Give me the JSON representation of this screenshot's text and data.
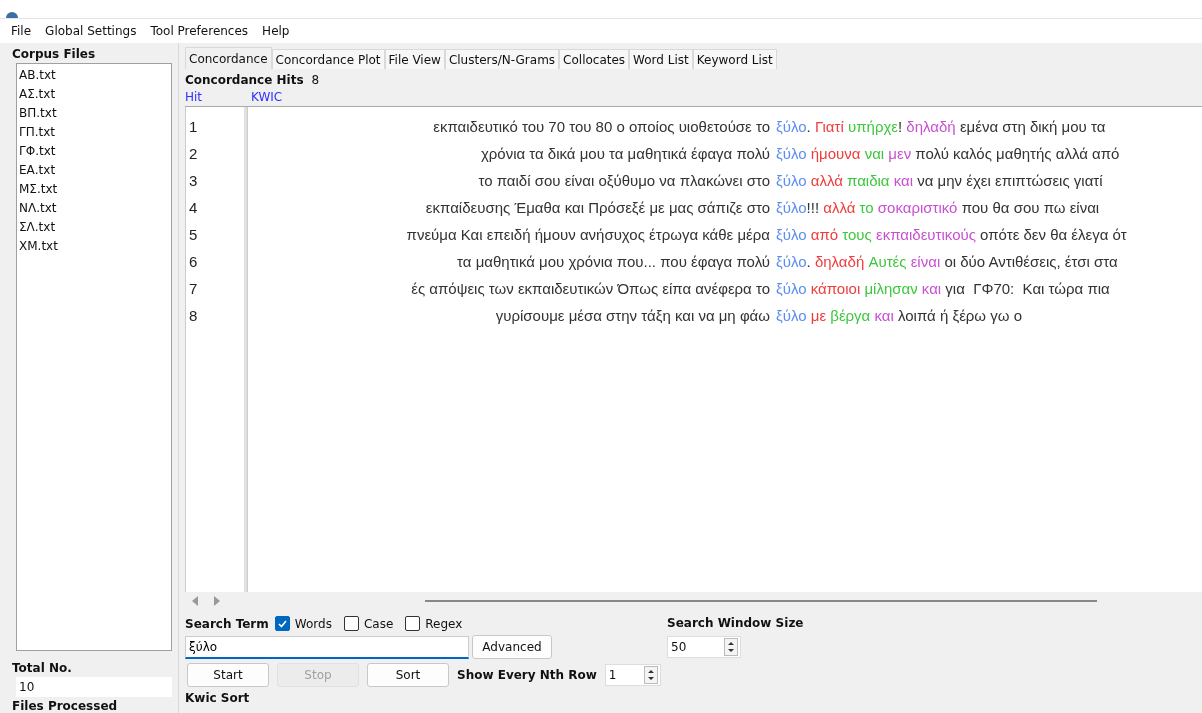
{
  "menu": [
    "File",
    "Global Settings",
    "Tool Preferences",
    "Help"
  ],
  "corpus_files": {
    "title": "Corpus Files",
    "items": [
      "AB.txt",
      "ΑΣ.txt",
      "ΒΠ.txt",
      "ΓΠ.txt",
      "ΓΦ.txt",
      "ΕΑ.txt",
      "ΜΣ.txt",
      "ΝΛ.txt",
      "ΣΛ.txt",
      "ΧΜ.txt"
    ]
  },
  "total": {
    "label": "Total No.",
    "value": "10"
  },
  "files_processed": {
    "label": "Files Processed"
  },
  "tabs": [
    {
      "label": "Concordance",
      "selected": true
    },
    {
      "label": "Concordance Plot",
      "selected": false
    },
    {
      "label": "File View",
      "selected": false
    },
    {
      "label": "Clusters/N-Grams",
      "selected": false
    },
    {
      "label": "Collocates",
      "selected": false
    },
    {
      "label": "Word List",
      "selected": false
    },
    {
      "label": "Keyword List",
      "selected": false
    }
  ],
  "hits": {
    "label": "Concordance Hits",
    "value": "8"
  },
  "columns": [
    "Hit",
    "KWIC"
  ],
  "rows": [
    {
      "hit": "1",
      "left": "εκπαιδευτικό του 70 του 80 ο οποίος υιοθετούσε το",
      "keyword": "ξύλο",
      "prefix": ".",
      "words": [
        {
          "text": "Γιατί",
          "color": "#f03c3c"
        },
        {
          "text": "υπήρχε",
          "color": "#3cc83c",
          "suffix": "!"
        },
        {
          "text": "δηλαδή",
          "color": "#c850d2"
        }
      ],
      "rest": "εμένα στη δική μου τα"
    },
    {
      "hit": "2",
      "left": "χρόνια τα δικά μου τα μαθητικά έφαγα πολύ",
      "keyword": "ξύλο",
      "words": [
        {
          "text": "ήμουνα",
          "color": "#f03c3c"
        },
        {
          "text": "ναι",
          "color": "#3cc83c"
        },
        {
          "text": "μεν",
          "color": "#c850d2"
        }
      ],
      "rest": "πολύ καλός μαθητής αλλά από"
    },
    {
      "hit": "3",
      "left": "το παιδί σου είναι οξύθυμο να πλακώνει στο",
      "keyword": "ξύλο",
      "words": [
        {
          "text": "αλλά",
          "color": "#f03c3c"
        },
        {
          "text": "παιδια",
          "color": "#3cc83c"
        },
        {
          "text": "και",
          "color": "#c850d2"
        }
      ],
      "rest": "να μην έχει επιπτώσεις γιατί"
    },
    {
      "hit": "4",
      "left": "εκπαίδευσης Έμαθα και Πρόσεξέ με μας σάπιζε στο",
      "keyword": "ξύλο",
      "prefix": "!!!",
      "words": [
        {
          "text": "αλλά",
          "color": "#f03c3c"
        },
        {
          "text": "το",
          "color": "#3cc83c"
        },
        {
          "text": "σοκαριστικό",
          "color": "#c850d2"
        }
      ],
      "rest": "που θα σου πω είναι"
    },
    {
      "hit": "5",
      "left": "πνεύμα Και επειδή ήμουν ανήσυχος έτρωγα κάθε μέρα",
      "keyword": "ξύλο",
      "words": [
        {
          "text": "από",
          "color": "#f03c3c"
        },
        {
          "text": "τους",
          "color": "#3cc83c"
        },
        {
          "text": "εκπαιδευτικούς",
          "color": "#c850d2"
        }
      ],
      "rest": "οπότε δεν θα έλεγα ότ"
    },
    {
      "hit": "6",
      "left": "τα μαθητικά μου χρόνια που... που  έφαγα πολύ",
      "keyword": "ξύλο",
      "prefix": ".",
      "words": [
        {
          "text": "δηλαδή",
          "color": "#f03c3c"
        },
        {
          "text": "Αυτές",
          "color": "#3cc83c"
        },
        {
          "text": "είναι",
          "color": "#c850d2"
        }
      ],
      "rest": "οι δύο Αντιθέσεις, έτσι στα"
    },
    {
      "hit": "7",
      "left": "ές απόψεις των εκπαιδευτικών Όπως είπα ανέφερα το",
      "keyword": "ξύλο",
      "words": [
        {
          "text": "κάποιοι",
          "color": "#f03c3c"
        },
        {
          "text": "μίλησαν",
          "color": "#3cc83c"
        },
        {
          "text": "και",
          "color": "#c850d2"
        }
      ],
      "rest": "για  ΓΦ70:  Και τώρα πια"
    },
    {
      "hit": "8",
      "left": "γυρίσουμε μέσα στην τάξη και να μη φάω",
      "keyword": "ξύλο",
      "words": [
        {
          "text": "με",
          "color": "#f03c3c"
        },
        {
          "text": "βέργα",
          "color": "#3cc83c"
        },
        {
          "text": "και",
          "color": "#c850d2"
        }
      ],
      "rest": "λοιπά ή ξέρω γω ο"
    }
  ],
  "search": {
    "label": "Search Term",
    "options": [
      {
        "label": "Words",
        "checked": true
      },
      {
        "label": "Case",
        "checked": false
      },
      {
        "label": "Regex",
        "checked": false
      }
    ],
    "value": "ξύλο",
    "advanced": "Advanced"
  },
  "window_size": {
    "label": "Search Window Size",
    "value": "50"
  },
  "buttons": [
    {
      "label": "Start",
      "disabled": false
    },
    {
      "label": "Stop",
      "disabled": true
    },
    {
      "label": "Sort",
      "disabled": false
    }
  ],
  "nth_row": {
    "label": "Show Every Nth Row",
    "value": "1"
  },
  "kwic_sort": {
    "label": "Kwic Sort"
  }
}
